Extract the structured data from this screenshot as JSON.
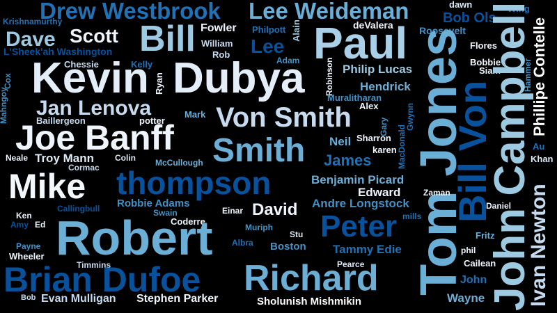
{
  "palette": {
    "background": "#000000",
    "white": "#eef5fc",
    "pale": "#c6dbef",
    "light": "#9ecae1",
    "mid": "#6baed6",
    "blue": "#4292c6",
    "medium": "#2171b5",
    "dark": "#08519c"
  },
  "words": [
    {
      "text": "Drew Westbrook",
      "color": "#2171b5"
    },
    {
      "text": "Lee Weideman",
      "color": "#6baed6"
    },
    {
      "text": "dawn",
      "color": "#dceaf6"
    },
    {
      "text": "Wing",
      "color": "#2171b5"
    },
    {
      "text": "Krishnamurthy",
      "color": "#2171b5"
    },
    {
      "text": "Bob Ols",
      "color": "#08519c"
    },
    {
      "text": "deValera",
      "color": "#eef5fc"
    },
    {
      "text": "Philpott",
      "color": "#2171b5"
    },
    {
      "text": "Fowler",
      "color": "#eef5fc"
    },
    {
      "text": "Scott",
      "color": "#eef5fc"
    },
    {
      "text": "Dave",
      "color": "#9ecae1"
    },
    {
      "text": "Bill",
      "color": "#9ecae1"
    },
    {
      "text": "Roosevelt",
      "color": "#4292c6"
    },
    {
      "text": "Alain",
      "color": "#9ecae1"
    },
    {
      "text": "Paul",
      "color": "#a9d0e6"
    },
    {
      "text": "William",
      "color": "#c6dbef"
    },
    {
      "text": "Lee",
      "color": "#08519c"
    },
    {
      "text": "L'Sheek'ah Washington",
      "color": "#08519c"
    },
    {
      "text": "Rob",
      "color": "#c6dbef"
    },
    {
      "text": "Flores",
      "color": "#eef5fc"
    },
    {
      "text": "Adam",
      "color": "#4292c6"
    },
    {
      "text": "Chessie",
      "color": "#c6dbef"
    },
    {
      "text": "Kelly",
      "color": "#2171b5"
    },
    {
      "text": "Bobbie",
      "color": "#eef5fc"
    },
    {
      "text": "Siam",
      "color": "#eef5fc"
    },
    {
      "text": "Philip Lucas",
      "color": "#9ecae1"
    },
    {
      "text": "Kevin",
      "color": "#e3eef9"
    },
    {
      "text": "Dubya",
      "color": "#e3eef9"
    },
    {
      "text": "Cox",
      "color": "#4292c6"
    },
    {
      "text": "Mahngoy",
      "color": "#4292c6"
    },
    {
      "text": "Ryan",
      "color": "#eef5fc"
    },
    {
      "text": "Robinson",
      "color": "#eef5fc"
    },
    {
      "text": "Hendrick",
      "color": "#6baed6"
    },
    {
      "text": "Hammer",
      "color": "#4292c6"
    },
    {
      "text": "Muralitharan",
      "color": "#4292c6"
    },
    {
      "text": "Alex",
      "color": "#eef5fc"
    },
    {
      "text": "Jan Lenova",
      "color": "#c6dbef"
    },
    {
      "text": "Mark",
      "color": "#6baed6"
    },
    {
      "text": "Baillergeon",
      "color": "#c6dbef"
    },
    {
      "text": "potter",
      "color": "#eef5fc"
    },
    {
      "text": "Von Smith",
      "color": "#c6dbef"
    },
    {
      "text": "Gary",
      "color": "#4292c6"
    },
    {
      "text": "MacDonald",
      "color": "#2171b5"
    },
    {
      "text": "Gwynn",
      "color": "#2171b5"
    },
    {
      "text": "Tom Jones",
      "color": "#6baed6"
    },
    {
      "text": "Bill Von",
      "color": "#08519c"
    },
    {
      "text": "John Campbell",
      "color": "#9ecae1"
    },
    {
      "text": "Phillipe Contelle",
      "color": "#ffffff"
    },
    {
      "text": "Joe Banff",
      "color": "#eef5fc"
    },
    {
      "text": "Smith",
      "color": "#6baed6"
    },
    {
      "text": "Neil",
      "color": "#6baed6"
    },
    {
      "text": "Sharron",
      "color": "#eef5fc"
    },
    {
      "text": "karen",
      "color": "#eef5fc"
    },
    {
      "text": "Au",
      "color": "#2171b5"
    },
    {
      "text": "Khan",
      "color": "#dceaf6"
    },
    {
      "text": "Neale",
      "color": "#eef5fc"
    },
    {
      "text": "Troy Mann",
      "color": "#dceaf6"
    },
    {
      "text": "Colin",
      "color": "#dceaf6"
    },
    {
      "text": "McCullough",
      "color": "#6baed6"
    },
    {
      "text": "Cormac",
      "color": "#c6dbef"
    },
    {
      "text": "James",
      "color": "#2171b5"
    },
    {
      "text": "Mike",
      "color": "#f3f8fd"
    },
    {
      "text": "thompson",
      "color": "#08519c"
    },
    {
      "text": "Benjamin Picard",
      "color": "#6baed6"
    },
    {
      "text": "Edward",
      "color": "#eef5fc"
    },
    {
      "text": "Zaman",
      "color": "#eef5fc"
    },
    {
      "text": "Ivan Newton",
      "color": "#c6dbef"
    },
    {
      "text": "Robbie Adams",
      "color": "#4292c6"
    },
    {
      "text": "Callingbull",
      "color": "#08519c"
    },
    {
      "text": "Swain",
      "color": "#4292c6"
    },
    {
      "text": "Einar",
      "color": "#eef5fc"
    },
    {
      "text": "David",
      "color": "#eef5fc"
    },
    {
      "text": "Andre Longstock",
      "color": "#4292c6"
    },
    {
      "text": "Daniel",
      "color": "#eef5fc"
    },
    {
      "text": "Ken",
      "color": "#eef5fc"
    },
    {
      "text": "Coderre",
      "color": "#eef5fc"
    },
    {
      "text": "mills",
      "color": "#2171b5"
    },
    {
      "text": "Amy",
      "color": "#08519c"
    },
    {
      "text": "Ed",
      "color": "#eef5fc"
    },
    {
      "text": "Muriph",
      "color": "#4292c6"
    },
    {
      "text": "Robert",
      "color": "#6baed6"
    },
    {
      "text": "Peter",
      "color": "#08519c"
    },
    {
      "text": "Stu",
      "color": "#dceaf6"
    },
    {
      "text": "Fritz",
      "color": "#6baed6"
    },
    {
      "text": "Albra",
      "color": "#2171b5"
    },
    {
      "text": "Boston",
      "color": "#4292c6"
    },
    {
      "text": "Payne",
      "color": "#4292c6"
    },
    {
      "text": "Tammy Edie",
      "color": "#2171b5"
    },
    {
      "text": "phil",
      "color": "#eef5fc"
    },
    {
      "text": "Wheeler",
      "color": "#eef5fc"
    },
    {
      "text": "Timmins",
      "color": "#c6dbef"
    },
    {
      "text": "Pearce",
      "color": "#dceaf6"
    },
    {
      "text": "Cailean",
      "color": "#eef5fc"
    },
    {
      "text": "Brian Dufoe",
      "color": "#08519c"
    },
    {
      "text": "Richard",
      "color": "#6baed6"
    },
    {
      "text": "John",
      "color": "#2171b5"
    },
    {
      "text": "Wayne",
      "color": "#6baed6"
    },
    {
      "text": "Bob",
      "color": "#c6dbef"
    },
    {
      "text": "Evan Mulligan",
      "color": "#c6dbef"
    },
    {
      "text": "Stephen Parker",
      "color": "#eef5fc"
    },
    {
      "text": "Sholunish Mishmikin",
      "color": "#ffffff"
    }
  ]
}
